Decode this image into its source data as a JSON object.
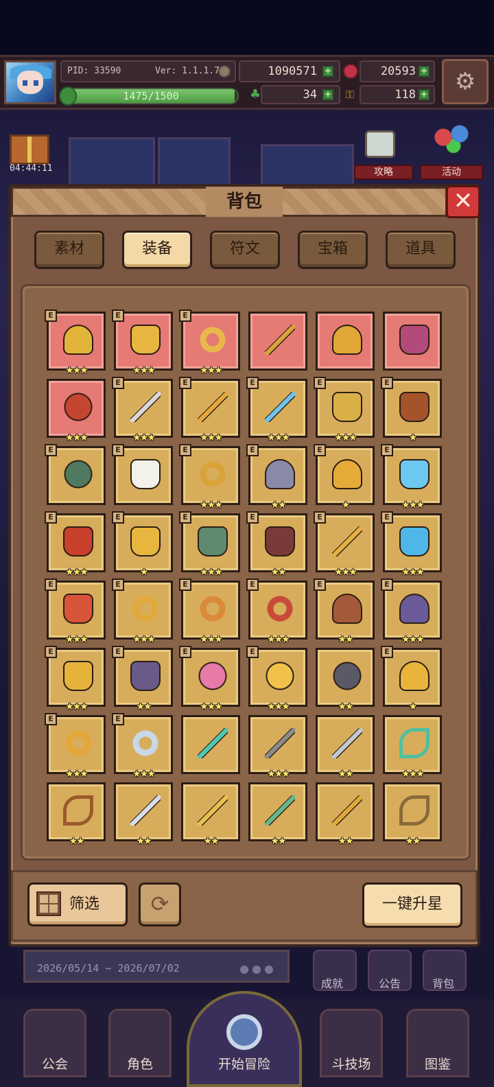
{
  "header": {
    "pid": "PID: 33590",
    "version": "Ver: 1.1.1.7",
    "gold": "1090571",
    "gems": "20593",
    "xp": "1475/1500",
    "xp_fraction": 0.983,
    "clovers": "34",
    "keys": "118"
  },
  "background": {
    "timer": "04:44:11",
    "guide_label": "攻略",
    "event_label": "活动",
    "event_date": "2026/05/14 ~ 2026/07/02",
    "achievements_label": "成就",
    "announcement_label": "公告",
    "bag_label": "背包"
  },
  "bottom_nav": [
    "公会",
    "角色",
    "开始冒险",
    "斗技场",
    "图鉴"
  ],
  "bag": {
    "title": "背包",
    "close_symbol": "✕",
    "tabs": [
      {
        "label": "素材",
        "active": false
      },
      {
        "label": "装备",
        "active": true
      },
      {
        "label": "符文",
        "active": false
      },
      {
        "label": "宝箱",
        "active": false
      },
      {
        "label": "道具",
        "active": false
      }
    ],
    "equipped_tag": "E",
    "items": [
      {
        "icon": "straw-hat-icon",
        "rarity": "red",
        "equipped": true,
        "stars": 3,
        "color": "#e2b43a"
      },
      {
        "icon": "amulet-icon",
        "rarity": "red",
        "equipped": true,
        "stars": 3,
        "color": "#e8b640"
      },
      {
        "icon": "ring-icon",
        "rarity": "red",
        "equipped": true,
        "stars": 3,
        "color": "#e9b84a"
      },
      {
        "icon": "wand-icon",
        "rarity": "red",
        "equipped": false,
        "stars": 0,
        "color": "#d9a33a"
      },
      {
        "icon": "horned-helm-icon",
        "rarity": "red",
        "equipped": false,
        "stars": 0,
        "color": "#e0a736"
      },
      {
        "icon": "pendant-icon",
        "rarity": "red",
        "equipped": false,
        "stars": 0,
        "color": "#b34a7a"
      },
      {
        "icon": "pot-icon",
        "rarity": "red",
        "equipped": false,
        "stars": 3,
        "color": "#c54630"
      },
      {
        "icon": "axe-icon",
        "rarity": "gold",
        "equipped": true,
        "stars": 3,
        "color": "#d8d8d8"
      },
      {
        "icon": "mace-icon",
        "rarity": "gold",
        "equipped": true,
        "stars": 3,
        "color": "#e5a83a"
      },
      {
        "icon": "spear-icon",
        "rarity": "gold",
        "equipped": true,
        "stars": 3,
        "color": "#6ec3e8"
      },
      {
        "icon": "scale-armor-icon",
        "rarity": "gold",
        "equipped": true,
        "stars": 3,
        "color": "#d9b048"
      },
      {
        "icon": "demon-armor-icon",
        "rarity": "gold",
        "equipped": true,
        "stars": 1,
        "color": "#a5532a"
      },
      {
        "icon": "orb-icon",
        "rarity": "gold",
        "equipped": true,
        "stars": 0,
        "color": "#4f7a60"
      },
      {
        "icon": "shield-icon",
        "rarity": "gold",
        "equipped": true,
        "stars": 0,
        "color": "#f2f2ea"
      },
      {
        "icon": "band-icon",
        "rarity": "gold",
        "equipped": true,
        "stars": 3,
        "color": "#d9a33a"
      },
      {
        "icon": "winged-helm-icon",
        "rarity": "gold",
        "equipped": true,
        "stars": 2,
        "color": "#8a8aa8"
      },
      {
        "icon": "crown-helm-icon",
        "rarity": "gold",
        "equipped": true,
        "stars": 1,
        "color": "#e5aa38"
      },
      {
        "icon": "ice-armor-icon",
        "rarity": "gold",
        "equipped": true,
        "stars": 3,
        "color": "#6cc8ef"
      },
      {
        "icon": "red-robe-icon",
        "rarity": "gold",
        "equipped": true,
        "stars": 3,
        "color": "#c8402c"
      },
      {
        "icon": "gold-robe-icon",
        "rarity": "gold",
        "equipped": true,
        "stars": 1,
        "color": "#e6b63e"
      },
      {
        "icon": "jade-armor-icon",
        "rarity": "gold",
        "equipped": true,
        "stars": 3,
        "color": "#5e8a70"
      },
      {
        "icon": "dark-armor-icon",
        "rarity": "gold",
        "equipped": true,
        "stars": 2,
        "color": "#7a3a3a"
      },
      {
        "icon": "scepter-icon",
        "rarity": "gold",
        "equipped": true,
        "stars": 3,
        "color": "#e6b040"
      },
      {
        "icon": "ice-gauntlet-icon",
        "rarity": "gold",
        "equipped": true,
        "stars": 3,
        "color": "#4fb7e8"
      },
      {
        "icon": "fire-boot-icon",
        "rarity": "gold",
        "equipped": true,
        "stars": 3,
        "color": "#d9553a"
      },
      {
        "icon": "ruby-ring-icon",
        "rarity": "gold",
        "equipped": true,
        "stars": 3,
        "color": "#e0aa3c"
      },
      {
        "icon": "bronze-ring-icon",
        "rarity": "gold",
        "equipped": true,
        "stars": 3,
        "color": "#d98a3a"
      },
      {
        "icon": "red-ring-icon",
        "rarity": "gold",
        "equipped": true,
        "stars": 3,
        "color": "#c84a3a"
      },
      {
        "icon": "beast-helm-icon",
        "rarity": "gold",
        "equipped": true,
        "stars": 2,
        "color": "#a45a3a"
      },
      {
        "icon": "void-helm-icon",
        "rarity": "gold",
        "equipped": true,
        "stars": 3,
        "color": "#6a5a9a"
      },
      {
        "icon": "gold-boots-icon",
        "rarity": "gold",
        "equipped": true,
        "stars": 3,
        "color": "#e5b23a"
      },
      {
        "icon": "purple-boots-icon",
        "rarity": "gold",
        "equipped": true,
        "stars": 2,
        "color": "#6a5a8a"
      },
      {
        "icon": "heart-charm-icon",
        "rarity": "gold",
        "equipped": true,
        "stars": 3,
        "color": "#e67aa8"
      },
      {
        "icon": "sun-charm-icon",
        "rarity": "gold",
        "equipped": true,
        "stars": 3,
        "color": "#f0c24a"
      },
      {
        "icon": "stone-orb-icon",
        "rarity": "gold",
        "equipped": false,
        "stars": 2,
        "color": "#5a5a66"
      },
      {
        "icon": "gold-mask-icon",
        "rarity": "gold",
        "equipped": true,
        "stars": 1,
        "color": "#e8b43c"
      },
      {
        "icon": "gem-ring-icon",
        "rarity": "gold",
        "equipped": true,
        "stars": 3,
        "color": "#e3a638"
      },
      {
        "icon": "silver-ring-icon",
        "rarity": "gold",
        "equipped": true,
        "stars": 3,
        "color": "#c8d8e8"
      },
      {
        "icon": "jade-staff-icon",
        "rarity": "gold",
        "equipped": false,
        "stars": 0,
        "color": "#4fc8b0"
      },
      {
        "icon": "hammer-axe-icon",
        "rarity": "gold",
        "equipped": false,
        "stars": 3,
        "color": "#8a8a8a"
      },
      {
        "icon": "crossed-swords-icon",
        "rarity": "gold",
        "equipped": false,
        "stars": 2,
        "color": "#c0c8d0"
      },
      {
        "icon": "jade-bow-icon",
        "rarity": "gold",
        "equipped": false,
        "stars": 3,
        "color": "#4fc0a0"
      },
      {
        "icon": "crossbow-icon",
        "rarity": "gold",
        "equipped": false,
        "stars": 2,
        "color": "#9a5a2a"
      },
      {
        "icon": "silver-mace-icon",
        "rarity": "gold",
        "equipped": false,
        "stars": 2,
        "color": "#d8dce8"
      },
      {
        "icon": "gold-scepter-icon",
        "rarity": "gold",
        "equipped": false,
        "stars": 2,
        "color": "#e8c050"
      },
      {
        "icon": "green-sword-icon",
        "rarity": "gold",
        "equipped": false,
        "stars": 2,
        "color": "#6ab88a"
      },
      {
        "icon": "gold-spear-icon",
        "rarity": "gold",
        "equipped": false,
        "stars": 2,
        "color": "#e0a838"
      },
      {
        "icon": "wood-bow-icon",
        "rarity": "gold",
        "equipped": false,
        "stars": 2,
        "color": "#8a6a3a"
      }
    ],
    "filter_label": "筛选",
    "refresh_symbol": "⟳",
    "upgrade_label": "一键升星"
  }
}
